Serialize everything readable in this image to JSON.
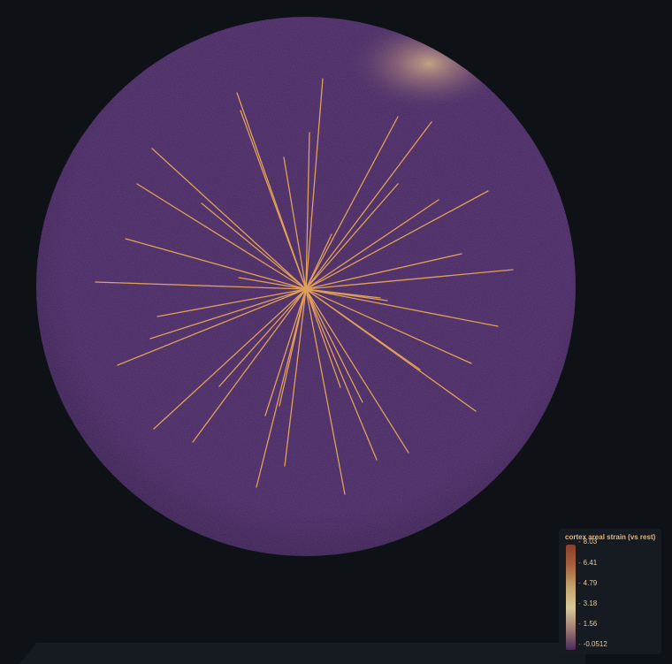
{
  "scene": {
    "background_color": "#0e1217",
    "sphere_fill": "#3d1d55",
    "sphere_highlight": "#e6c88a",
    "fiber_color": "#e0a05a"
  },
  "legend": {
    "title": "cortex areal strain (vs rest)",
    "ticks": [
      "8.03",
      "6.41",
      "4.79",
      "3.18",
      "1.56",
      "-0.0512"
    ],
    "colors": [
      "#8a3e2c",
      "#a8623f",
      "#c4a36a",
      "#d8c99a",
      "#a07c72",
      "#4a2a5c"
    ]
  }
}
